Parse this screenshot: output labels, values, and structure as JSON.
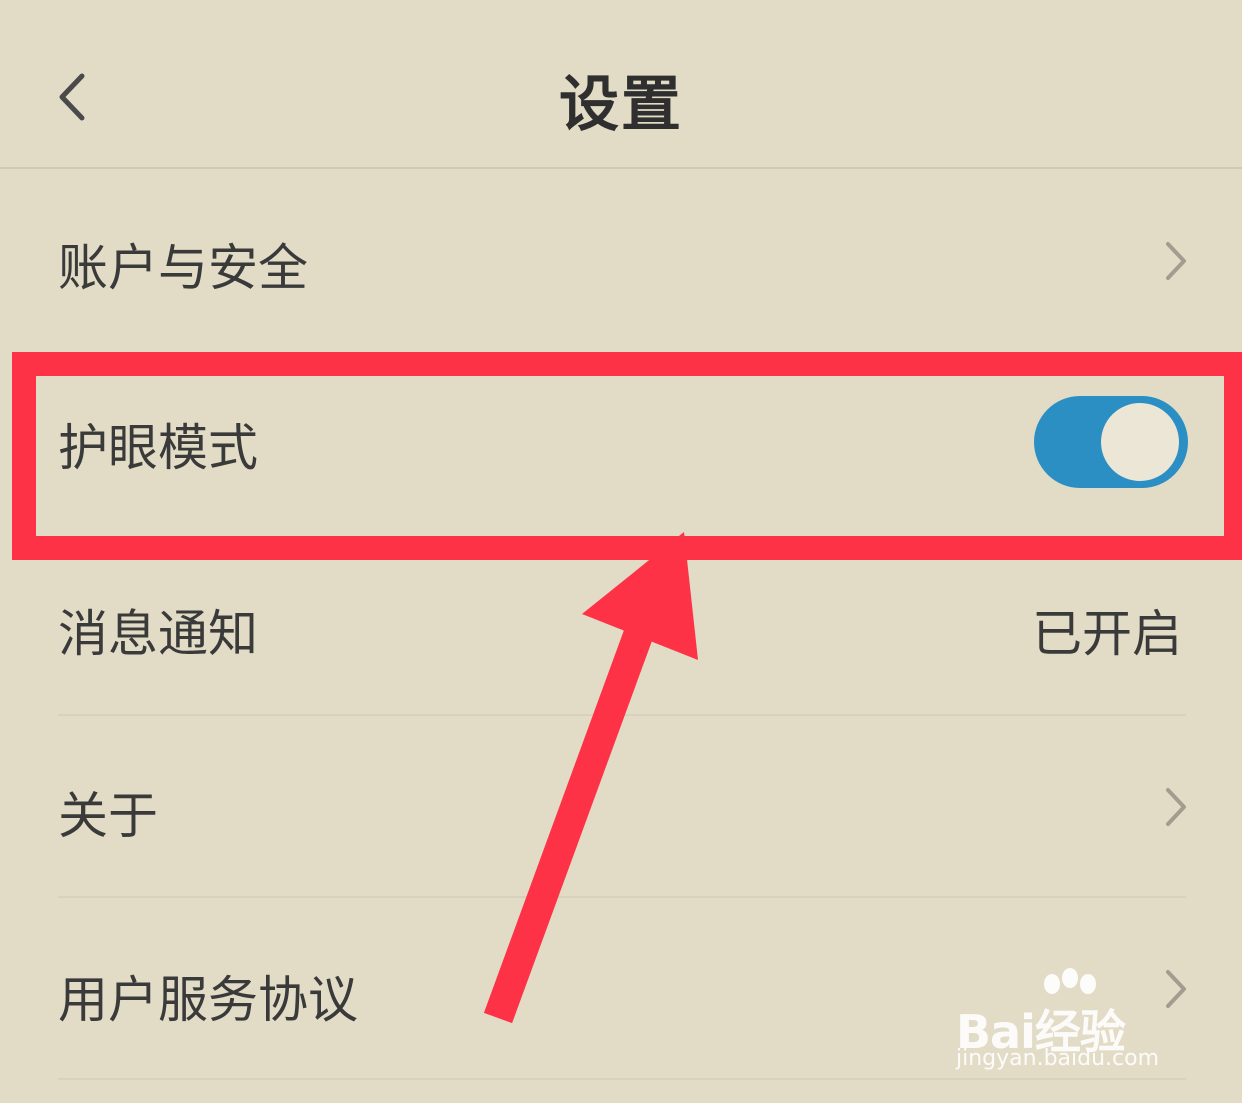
{
  "header": {
    "title": "设置"
  },
  "rows": [
    {
      "label": "账户与安全"
    },
    {
      "label": "护眼模式",
      "toggle": {
        "on": true,
        "color": "#2b8fc4"
      }
    },
    {
      "label": "消息通知",
      "value": "已开启"
    },
    {
      "label": "关于"
    },
    {
      "label": "用户服务协议"
    }
  ],
  "annotation": {
    "color": "#fd3246"
  },
  "watermark": {
    "brand": "Bai经验",
    "url": "jingyan.baidu.com"
  },
  "colors": {
    "background": "#e2dcc7"
  }
}
